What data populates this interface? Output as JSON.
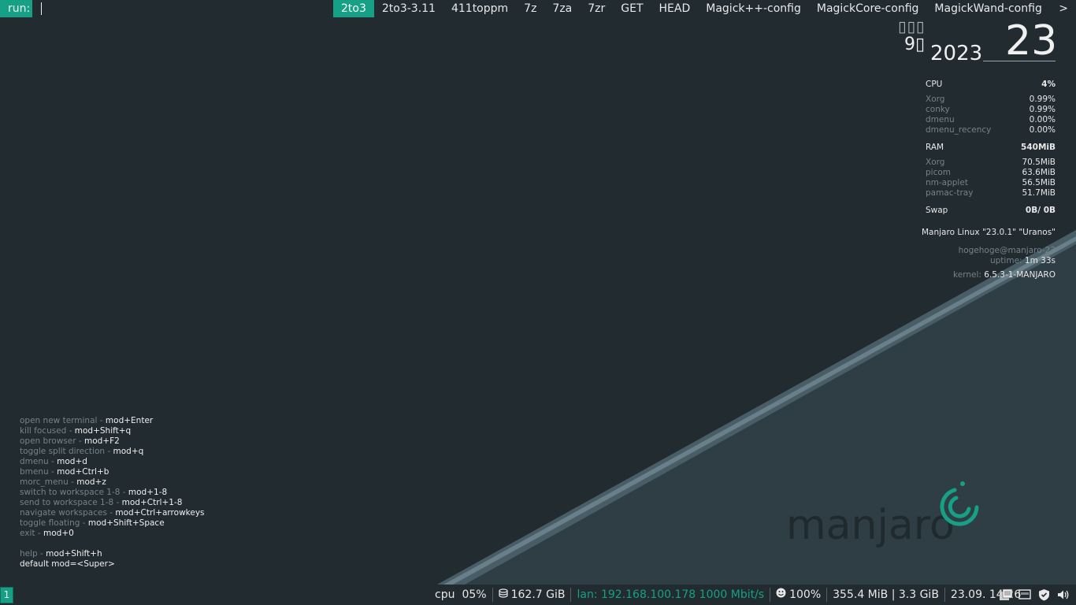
{
  "dmenu": {
    "prompt": "run:",
    "items": [
      "2to3",
      "2to3-3.11",
      "411toppm",
      "7z",
      "7za",
      "7zr",
      "GET",
      "HEAD",
      "Magick++-config",
      "MagickCore-config",
      "MagickWand-config"
    ],
    "selected_index": 0,
    "more_indicator": ">"
  },
  "clock": {
    "weekday_glyphs": "▯▯▯",
    "month": "9▯",
    "year": "2023",
    "day": "23"
  },
  "conky": {
    "cpu": {
      "label": "CPU",
      "value": "4%",
      "processes": [
        {
          "name": "Xorg",
          "value": "0.99%"
        },
        {
          "name": "conky",
          "value": "0.99%"
        },
        {
          "name": "dmenu",
          "value": "0.00%"
        },
        {
          "name": "dmenu_recency",
          "value": "0.00%"
        }
      ]
    },
    "ram": {
      "label": "RAM",
      "value": "540MiB",
      "processes": [
        {
          "name": "Xorg",
          "value": "70.5MiB"
        },
        {
          "name": "picom",
          "value": "63.6MiB"
        },
        {
          "name": "nm-applet",
          "value": "56.5MiB"
        },
        {
          "name": "pamac-tray",
          "value": "51.7MiB"
        }
      ]
    },
    "swap": {
      "label": "Swap",
      "value": "0B/ 0B"
    },
    "distro": "Manjaro Linux \"23.0.1\" \"Uranos\"",
    "user_host": "hogehoge@manjaro-23",
    "uptime_label": "uptime:",
    "uptime_value": "1m 33s",
    "kernel_label": "kernel:",
    "kernel_value": "6.5.3-1-MANJARO"
  },
  "help": [
    {
      "desc": "open new terminal - ",
      "key": "mod+Enter"
    },
    {
      "desc": "kill focused - ",
      "key": "mod+Shift+q"
    },
    {
      "desc": "open browser - ",
      "key": "mod+F2"
    },
    {
      "desc": "toggle split direction - ",
      "key": "mod+q"
    },
    {
      "desc": "dmenu - ",
      "key": "mod+d"
    },
    {
      "desc": "bmenu - ",
      "key": "mod+Ctrl+b"
    },
    {
      "desc": "morc_menu - ",
      "key": "mod+z"
    },
    {
      "desc": "switch to workspace 1-8 - ",
      "key": "mod+1-8"
    },
    {
      "desc": "send to workspace 1-8 - ",
      "key": "mod+Ctrl+1-8"
    },
    {
      "desc": "navigate workspaces - ",
      "key": "mod+Ctrl+arrowkeys"
    },
    {
      "desc": "toggle floating - ",
      "key": "mod+Shift+Space"
    },
    {
      "desc": "exit - ",
      "key": "mod+0"
    },
    {
      "desc": "",
      "key": ""
    },
    {
      "desc": "help - ",
      "key": "mod+Shift+h"
    },
    {
      "desc": "",
      "key": "default mod=<Super>"
    }
  ],
  "wallpaper": {
    "logo_text": "manjaro"
  },
  "bar": {
    "workspace": "1",
    "cpu_label": "cpu",
    "cpu_value": "05%",
    "disk": "162.7 GiB",
    "lan": "lan: 192.168.100.178 1000 Mbit/s",
    "battery": "100%",
    "mem": "355.4 MiB | 3.3 GiB",
    "datetime": "23.09. 14:26"
  },
  "icons": [
    "disk-icon",
    "smiley-icon",
    "clipboard-icon",
    "network-icon",
    "shield-icon",
    "volume-icon"
  ],
  "colors": {
    "accent": "#16a085",
    "background": "#222b30",
    "dim_text": "#75828a"
  }
}
